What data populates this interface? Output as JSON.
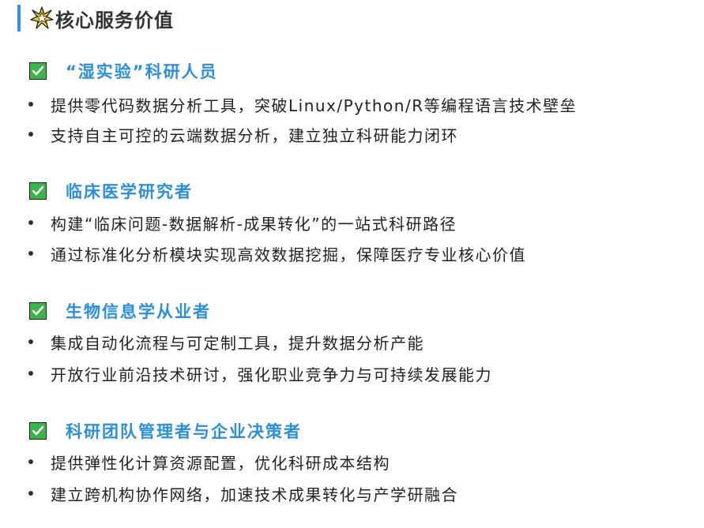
{
  "header": {
    "title": "核心服务价值",
    "icon": "sparkle-star-icon"
  },
  "sections": [
    {
      "title": "“湿实验”科研人员",
      "bullets": [
        "提供零代码数据分析工具，突破Linux/Python/R等编程语言技术壁垒",
        "支持自主可控的云端数据分析，建立独立科研能力闭环"
      ]
    },
    {
      "title": "临床医学研究者",
      "bullets": [
        "构建“临床问题-数据解析-成果转化”的一站式科研路径",
        "通过标准化分析模块实现高效数据挖掘，保障医疗专业核心价值"
      ]
    },
    {
      "title": "生物信息学从业者",
      "bullets": [
        "集成自动化流程与可定制工具，提升数据分析产能",
        "开放行业前沿技术研讨，强化职业竞争力与可持续发展能力"
      ]
    },
    {
      "title": "科研团队管理者与企业决策者",
      "bullets": [
        "提供弹性化计算资源配置，优化科研成本结构",
        "建立跨机构协作网络，加速技术成果转化与产学研融合"
      ]
    }
  ],
  "colors": {
    "accent_bar": "#2f8ef0",
    "section_title": "#2b8fe0",
    "check_green": "#3bb54a"
  }
}
